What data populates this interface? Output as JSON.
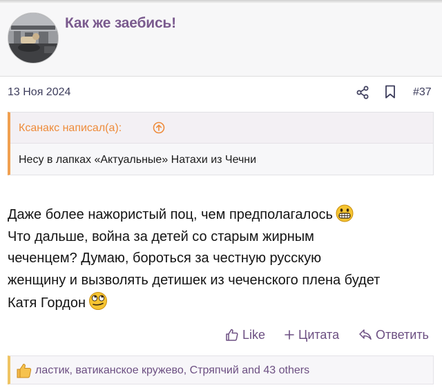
{
  "post": {
    "username": "Как же заебись!",
    "date": "13 Ноя 2024",
    "number": "#37",
    "icons": {
      "share": "share-icon",
      "bookmark": "bookmark-icon",
      "avatar": "avatar"
    }
  },
  "quote": {
    "author": "Ксанакс написал(а):",
    "text": "Несу в лапках «Актуальные» Натахи из Чечни",
    "icon": "arrow-up-circle-icon"
  },
  "body": {
    "lines": [
      "Даже более нажористый поц, чем предполагалось",
      "Что дальше, война за детей со старым жирным",
      "чеченцем? Думаю, бороться за честную русскую",
      "женщину и вызволять детишек из чеченского плена будет",
      "Катя Гордон"
    ],
    "emojis": [
      "grinning-teeth-emoji",
      "eye-roll-emoji"
    ]
  },
  "actions": {
    "like": "Like",
    "quote": "Цитата",
    "reply": "Ответить"
  },
  "reactions": {
    "text": "ластик, ватиканское кружево, Стряпчий and 43 others",
    "icon": "thumbs-up-icon"
  },
  "colors": {
    "username": "#7a5a8e",
    "quote_border": "#f0a050",
    "quote_author": "#ee8b3a",
    "action": "#6c4f82",
    "reactions_border": "#efc463"
  }
}
